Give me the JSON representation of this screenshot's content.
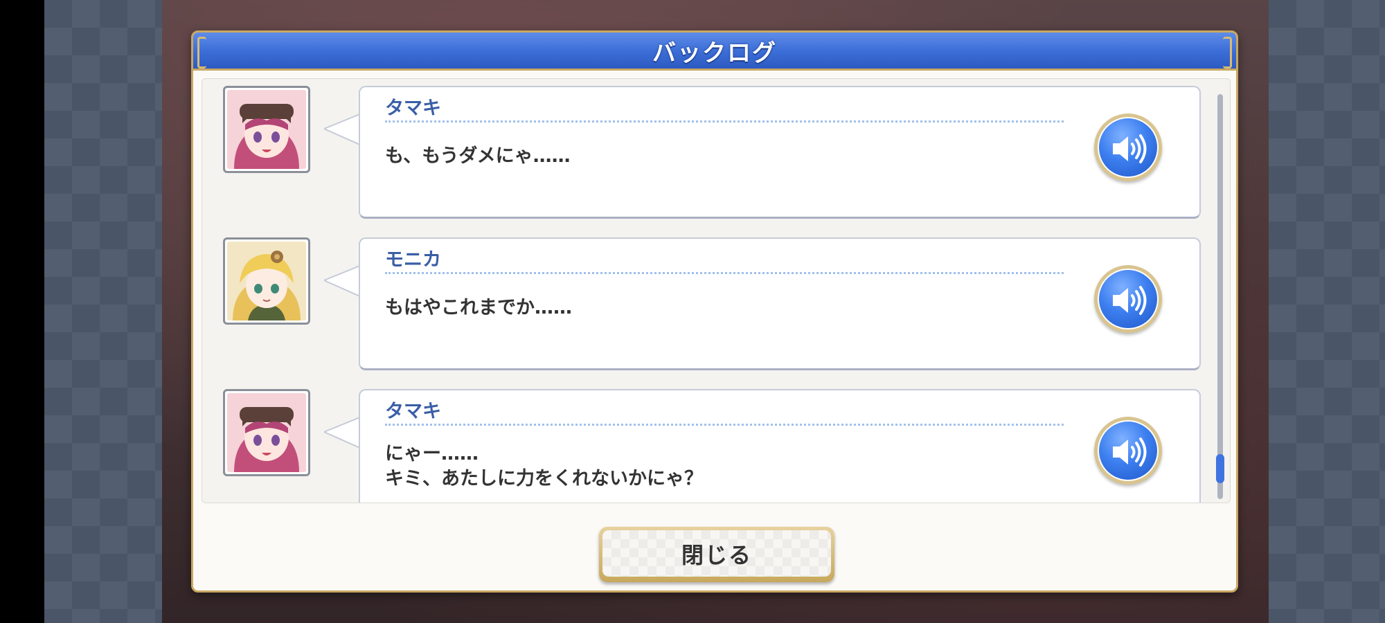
{
  "dialog": {
    "title": "バックログ",
    "close_label": "閉じる"
  },
  "entries": [
    {
      "speaker": "タマキ",
      "message": "も、もうダメにゃ……",
      "portrait": "tamaki-portrait",
      "voice_icon": "speaker-icon"
    },
    {
      "speaker": "モニカ",
      "message": "もはやこれまでか……",
      "portrait": "monika-portrait",
      "voice_icon": "speaker-icon"
    },
    {
      "speaker": "タマキ",
      "message": "にゃー……\nキミ、あたしに力をくれないかにゃ？",
      "portrait": "tamaki-portrait",
      "voice_icon": "speaker-icon"
    }
  ],
  "colors": {
    "title_bar": "#3d6fd8",
    "frame_gold": "#c9a863",
    "speaker_name": "#3a5ea6",
    "voice_button": "#3d7ff0",
    "scroll_thumb": "#3f73e0"
  },
  "scroll": {
    "position_fraction": 1.0
  }
}
